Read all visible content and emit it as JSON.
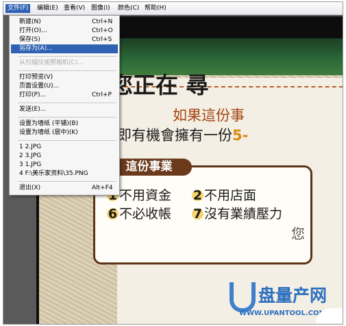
{
  "menubar": {
    "file": "文件(F)",
    "edit": "编辑(E)",
    "view": "查看(V)",
    "image": "图像(I)",
    "color": "颜色(C)",
    "help": "帮助(H)"
  },
  "file_menu": {
    "new": {
      "label": "新建(N)",
      "shortcut": "Ctrl+N"
    },
    "open": {
      "label": "打开(O)...",
      "shortcut": "Ctrl+O"
    },
    "save": {
      "label": "保存(S)",
      "shortcut": "Ctrl+S"
    },
    "save_as": {
      "label": "另存为(A)..."
    },
    "scan": {
      "label": "从扫描仪或照相机(C)..."
    },
    "print_preview": {
      "label": "打印预览(V)"
    },
    "page_setup": {
      "label": "页面设置(U)..."
    },
    "print": {
      "label": "打印(P)...",
      "shortcut": "Ctrl+P"
    },
    "send": {
      "label": "发送(E)..."
    },
    "wallpaper_tile": {
      "label": "设置为墙纸 (平铺)(B)"
    },
    "wallpaper_center": {
      "label": "设置为墙纸 (居中)(K)"
    },
    "recent": [
      "1 2.JPG",
      "2 3.JPG",
      "3 1.JPG",
      "4 F:\\美乐家资料\\35.PNG"
    ],
    "exit": {
      "label": "退出(X)",
      "shortcut": "Alt+F4"
    }
  },
  "image": {
    "title": "您正在 尋",
    "line1": "如果這份事",
    "line2_prefix": "即有機會擁有一份",
    "line2_highlight": "5-",
    "box_header": "這份事業",
    "features": [
      {
        "num": "1",
        "text": "不用資金"
      },
      {
        "num": "2",
        "text": "不用店面"
      },
      {
        "num": "6",
        "text": "不必收帳"
      },
      {
        "num": "7",
        "text": "沒有業績壓力"
      }
    ],
    "partial": "您"
  },
  "watermark": {
    "brand": "盘量产网",
    "url": "WWW.UPANTOOL.COM"
  }
}
